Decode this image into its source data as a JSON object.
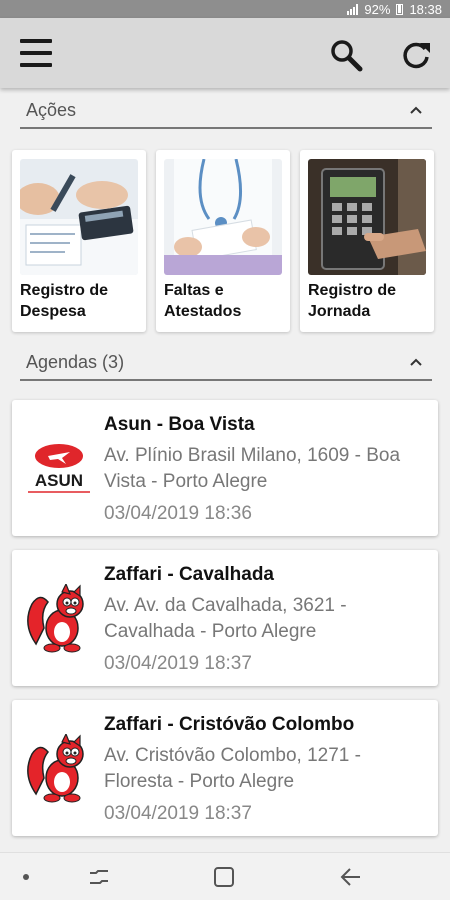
{
  "status_bar": {
    "battery": "92%",
    "time": "18:38"
  },
  "app_bar": {},
  "acoes": {
    "title": "Ações",
    "items": [
      {
        "label": "Registro de\nDespesa",
        "icon": "calculator-photo"
      },
      {
        "label": "Faltas e\nAtestados",
        "icon": "doctor-photo"
      },
      {
        "label": "Registro de\nJornada",
        "icon": "time-clock-photo"
      }
    ]
  },
  "agendas": {
    "title": "Agendas (3)",
    "items": [
      {
        "name": "Asun - Boa Vista",
        "address": "Av. Plínio Brasil Milano, 1609 - Boa Vista - Porto Alegre",
        "datetime": "03/04/2019 18:36",
        "logo": "asun-logo",
        "logo_text": "ASUN"
      },
      {
        "name": "Zaffari - Cavalhada",
        "address": "Av. Av. da Cavalhada, 3621 - Cavalhada - Porto Alegre",
        "datetime": "03/04/2019 18:37",
        "logo": "zaffari-squirrel-logo"
      },
      {
        "name": "Zaffari - Cristóvão Colombo",
        "address": "Av. Cristóvão Colombo, 1271 - Floresta - Porto Alegre",
        "datetime": "03/04/2019 18:37",
        "logo": "zaffari-squirrel-logo"
      }
    ]
  },
  "colors": {
    "app_bar": "#d9d9d9",
    "background": "#f0f0f0",
    "asun_red": "#e0262b",
    "zaffari_red": "#e4242a"
  }
}
